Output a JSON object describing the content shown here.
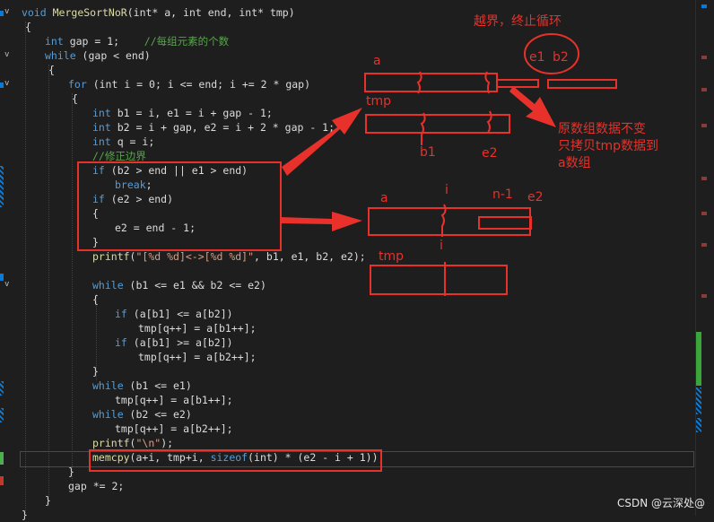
{
  "code_lines": [
    {
      "id": "l1",
      "parts": [
        [
          "kw",
          "void "
        ],
        [
          "fn",
          "MergeSortNoR"
        ],
        [
          "",
          "(int* a, int end, int* tmp)"
        ]
      ]
    },
    {
      "id": "l2",
      "parts": [
        [
          "",
          "{"
        ]
      ]
    },
    {
      "id": "l3",
      "parts": [
        [
          "kw",
          "int "
        ],
        [
          "",
          "gap = 1;    "
        ],
        [
          "cm",
          "//每组元素的个数"
        ]
      ]
    },
    {
      "id": "l4",
      "parts": [
        [
          "kw",
          "while "
        ],
        [
          "",
          "(gap < end)"
        ]
      ]
    },
    {
      "id": "l5",
      "parts": [
        [
          "",
          "{"
        ]
      ]
    },
    {
      "id": "l6",
      "parts": [
        [
          "kw",
          "for "
        ],
        [
          "",
          "(int i = 0; i <= end; i += 2 * gap)"
        ]
      ]
    },
    {
      "id": "l7",
      "parts": [
        [
          "",
          "{"
        ]
      ]
    },
    {
      "id": "l8",
      "parts": [
        [
          "kw",
          "int "
        ],
        [
          "",
          "b1 = i, e1 = i + gap - 1;"
        ]
      ]
    },
    {
      "id": "l9",
      "parts": [
        [
          "kw",
          "int "
        ],
        [
          "",
          "b2 = i + gap, e2 = i + 2 * gap - 1;"
        ]
      ]
    },
    {
      "id": "l10",
      "parts": [
        [
          "kw",
          "int "
        ],
        [
          "",
          "q = i;"
        ]
      ]
    },
    {
      "id": "l11",
      "parts": [
        [
          "cm",
          "//修正边界"
        ]
      ]
    },
    {
      "id": "l12",
      "parts": [
        [
          "kw",
          "if "
        ],
        [
          "",
          "(b2 > end || e1 > end)"
        ]
      ]
    },
    {
      "id": "l13",
      "parts": [
        [
          "kw",
          "break"
        ],
        [
          "",
          ";"
        ]
      ]
    },
    {
      "id": "l14",
      "parts": [
        [
          "kw",
          "if "
        ],
        [
          "",
          "(e2 > end)"
        ]
      ]
    },
    {
      "id": "l15",
      "parts": [
        [
          "",
          "{"
        ]
      ]
    },
    {
      "id": "l16",
      "parts": [
        [
          "",
          "e2 = end - 1;"
        ]
      ]
    },
    {
      "id": "l17",
      "parts": [
        [
          "",
          "}"
        ]
      ]
    },
    {
      "id": "l18",
      "parts": [
        [
          "fn",
          "printf"
        ],
        [
          "",
          "("
        ],
        [
          "str",
          "\"[%d %d]<->[%d %d]\""
        ],
        [
          "",
          ", b1, e1, b2, e2);"
        ]
      ]
    },
    {
      "id": "l19",
      "parts": [
        [
          "",
          ""
        ]
      ]
    },
    {
      "id": "l20",
      "parts": [
        [
          "kw",
          "while "
        ],
        [
          "",
          "(b1 <= e1 && b2 <= e2)"
        ]
      ]
    },
    {
      "id": "l21",
      "parts": [
        [
          "",
          "{"
        ]
      ]
    },
    {
      "id": "l22",
      "parts": [
        [
          "kw",
          "if "
        ],
        [
          "",
          "(a[b1] <= a[b2])"
        ]
      ]
    },
    {
      "id": "l23",
      "parts": [
        [
          "",
          "tmp[q++] = a[b1++];"
        ]
      ]
    },
    {
      "id": "l24",
      "parts": [
        [
          "kw",
          "if "
        ],
        [
          "",
          "(a[b1] >= a[b2])"
        ]
      ]
    },
    {
      "id": "l25",
      "parts": [
        [
          "",
          "tmp[q++] = a[b2++];"
        ]
      ]
    },
    {
      "id": "l26",
      "parts": [
        [
          "",
          "}"
        ]
      ]
    },
    {
      "id": "l27",
      "parts": [
        [
          "kw",
          "while "
        ],
        [
          "",
          "(b1 <= e1)"
        ]
      ]
    },
    {
      "id": "l28",
      "parts": [
        [
          "",
          "tmp[q++] = a[b1++];"
        ]
      ]
    },
    {
      "id": "l29",
      "parts": [
        [
          "kw",
          "while "
        ],
        [
          "",
          "(b2 <= e2)"
        ]
      ]
    },
    {
      "id": "l30",
      "parts": [
        [
          "",
          "tmp[q++] = a[b2++];"
        ]
      ]
    },
    {
      "id": "l31",
      "parts": [
        [
          "fn",
          "printf"
        ],
        [
          "",
          "("
        ],
        [
          "str",
          "\"\\n\""
        ],
        [
          "",
          ");"
        ]
      ]
    },
    {
      "id": "l32",
      "parts": [
        [
          "fn",
          "memcpy"
        ],
        [
          "",
          "(a+i, tmp+i, "
        ],
        [
          "kw",
          "sizeof"
        ],
        [
          "",
          "(int) * (e2 - i + 1));"
        ]
      ]
    },
    {
      "id": "l33",
      "parts": [
        [
          "",
          "}"
        ]
      ]
    },
    {
      "id": "l34",
      "parts": [
        [
          "",
          "gap *= 2;"
        ]
      ]
    },
    {
      "id": "l35",
      "parts": [
        [
          "",
          "}"
        ]
      ]
    },
    {
      "id": "l36",
      "parts": [
        [
          "",
          "}"
        ]
      ]
    }
  ],
  "annotations": {
    "out_of_bounds": "越界，终止循环",
    "e1": "e1",
    "b2": "b2",
    "a_top": "a",
    "tmp_top": "tmp",
    "b1": "b1",
    "e2_top": "e2",
    "note_line1": "原数组数据不变",
    "note_line2": "只拷贝tmp数据到",
    "note_line3": "a数组",
    "a_bottom": "a",
    "i_top": "i",
    "n_minus_1": "n-1",
    "e2_bottom": "e2",
    "i_bottom": "i",
    "tmp_bottom": "tmp"
  },
  "watermark": "CSDN @云深处@",
  "colors": {
    "accent_red": "#e8312a",
    "keyword": "#569cd6",
    "function": "#dcdcaa",
    "comment": "#57a64a",
    "string": "#d69d85"
  }
}
